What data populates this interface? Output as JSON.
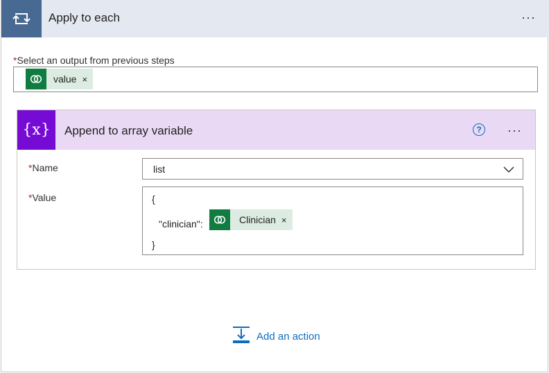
{
  "apply_to_each": {
    "title": "Apply to each",
    "more_label": "···",
    "select_label": "Select an output from previous steps",
    "required_mark": "*",
    "token": {
      "label": "value",
      "remove": "×"
    }
  },
  "append_action": {
    "icon_text": "{x}",
    "title": "Append to array variable",
    "help_label": "?",
    "more_label": "···",
    "name_label": "Name",
    "name_value": "list",
    "value_label": "Value",
    "value_open_brace": "{",
    "value_key": "\"clinician\":",
    "value_token": {
      "label": "Clinician",
      "remove": "×"
    },
    "value_close_brace": "}"
  },
  "footer": {
    "add_action_label": "Add an action"
  },
  "colors": {
    "loop_accent": "#486991",
    "variable_accent": "#770bd6",
    "dataverse_green": "#107c41",
    "token_bg": "#dcece2",
    "link_blue": "#0f6cbd"
  }
}
